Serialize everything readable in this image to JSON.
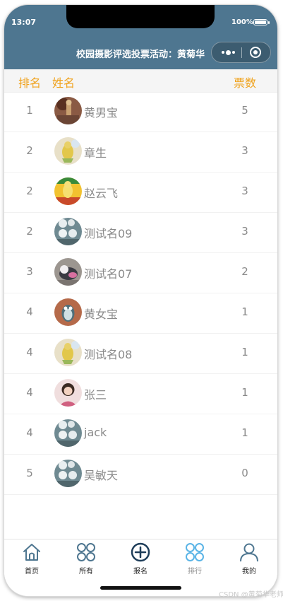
{
  "status_bar": {
    "time": "13:07",
    "battery": "100%"
  },
  "nav": {
    "title": "校园摄影评选投票活动：黄菊华"
  },
  "table": {
    "headers": {
      "rank": "排名",
      "name": "姓名",
      "votes": "票数"
    },
    "rows": [
      {
        "rank": "1",
        "name": "黄男宝",
        "votes": "5",
        "avatar": "avatar-figurine"
      },
      {
        "rank": "2",
        "name": "章生",
        "votes": "3",
        "avatar": "avatar-yellow-figure"
      },
      {
        "rank": "2",
        "name": "赵云飞",
        "votes": "3",
        "avatar": "avatar-duck-yellow"
      },
      {
        "rank": "2",
        "name": "测试名09",
        "votes": "3",
        "avatar": "avatar-toys"
      },
      {
        "rank": "3",
        "name": "测试名07",
        "votes": "2",
        "avatar": "avatar-cat"
      },
      {
        "rank": "4",
        "name": "黄女宝",
        "votes": "1",
        "avatar": "avatar-owl"
      },
      {
        "rank": "4",
        "name": "测试名08",
        "votes": "1",
        "avatar": "avatar-yellow-figure"
      },
      {
        "rank": "4",
        "name": "张三",
        "votes": "1",
        "avatar": "avatar-girl"
      },
      {
        "rank": "4",
        "name": "jack",
        "votes": "1",
        "avatar": "avatar-toys"
      },
      {
        "rank": "5",
        "name": "吴敏天",
        "votes": "0",
        "avatar": "avatar-toys"
      }
    ]
  },
  "tabbar": {
    "items": [
      {
        "label": "首页",
        "icon": "home-icon"
      },
      {
        "label": "所有",
        "icon": "clover-icon"
      },
      {
        "label": "报名",
        "icon": "plus-circle-icon"
      },
      {
        "label": "排行",
        "icon": "clover-icon",
        "active": true
      },
      {
        "label": "我的",
        "icon": "user-icon"
      }
    ]
  },
  "watermark": "CSDN @黄菊华老师",
  "colors": {
    "header": "#4e7690",
    "accent": "#f0a31e",
    "active_tab": "#5ab4e6",
    "text_muted": "#8a8a8a"
  }
}
